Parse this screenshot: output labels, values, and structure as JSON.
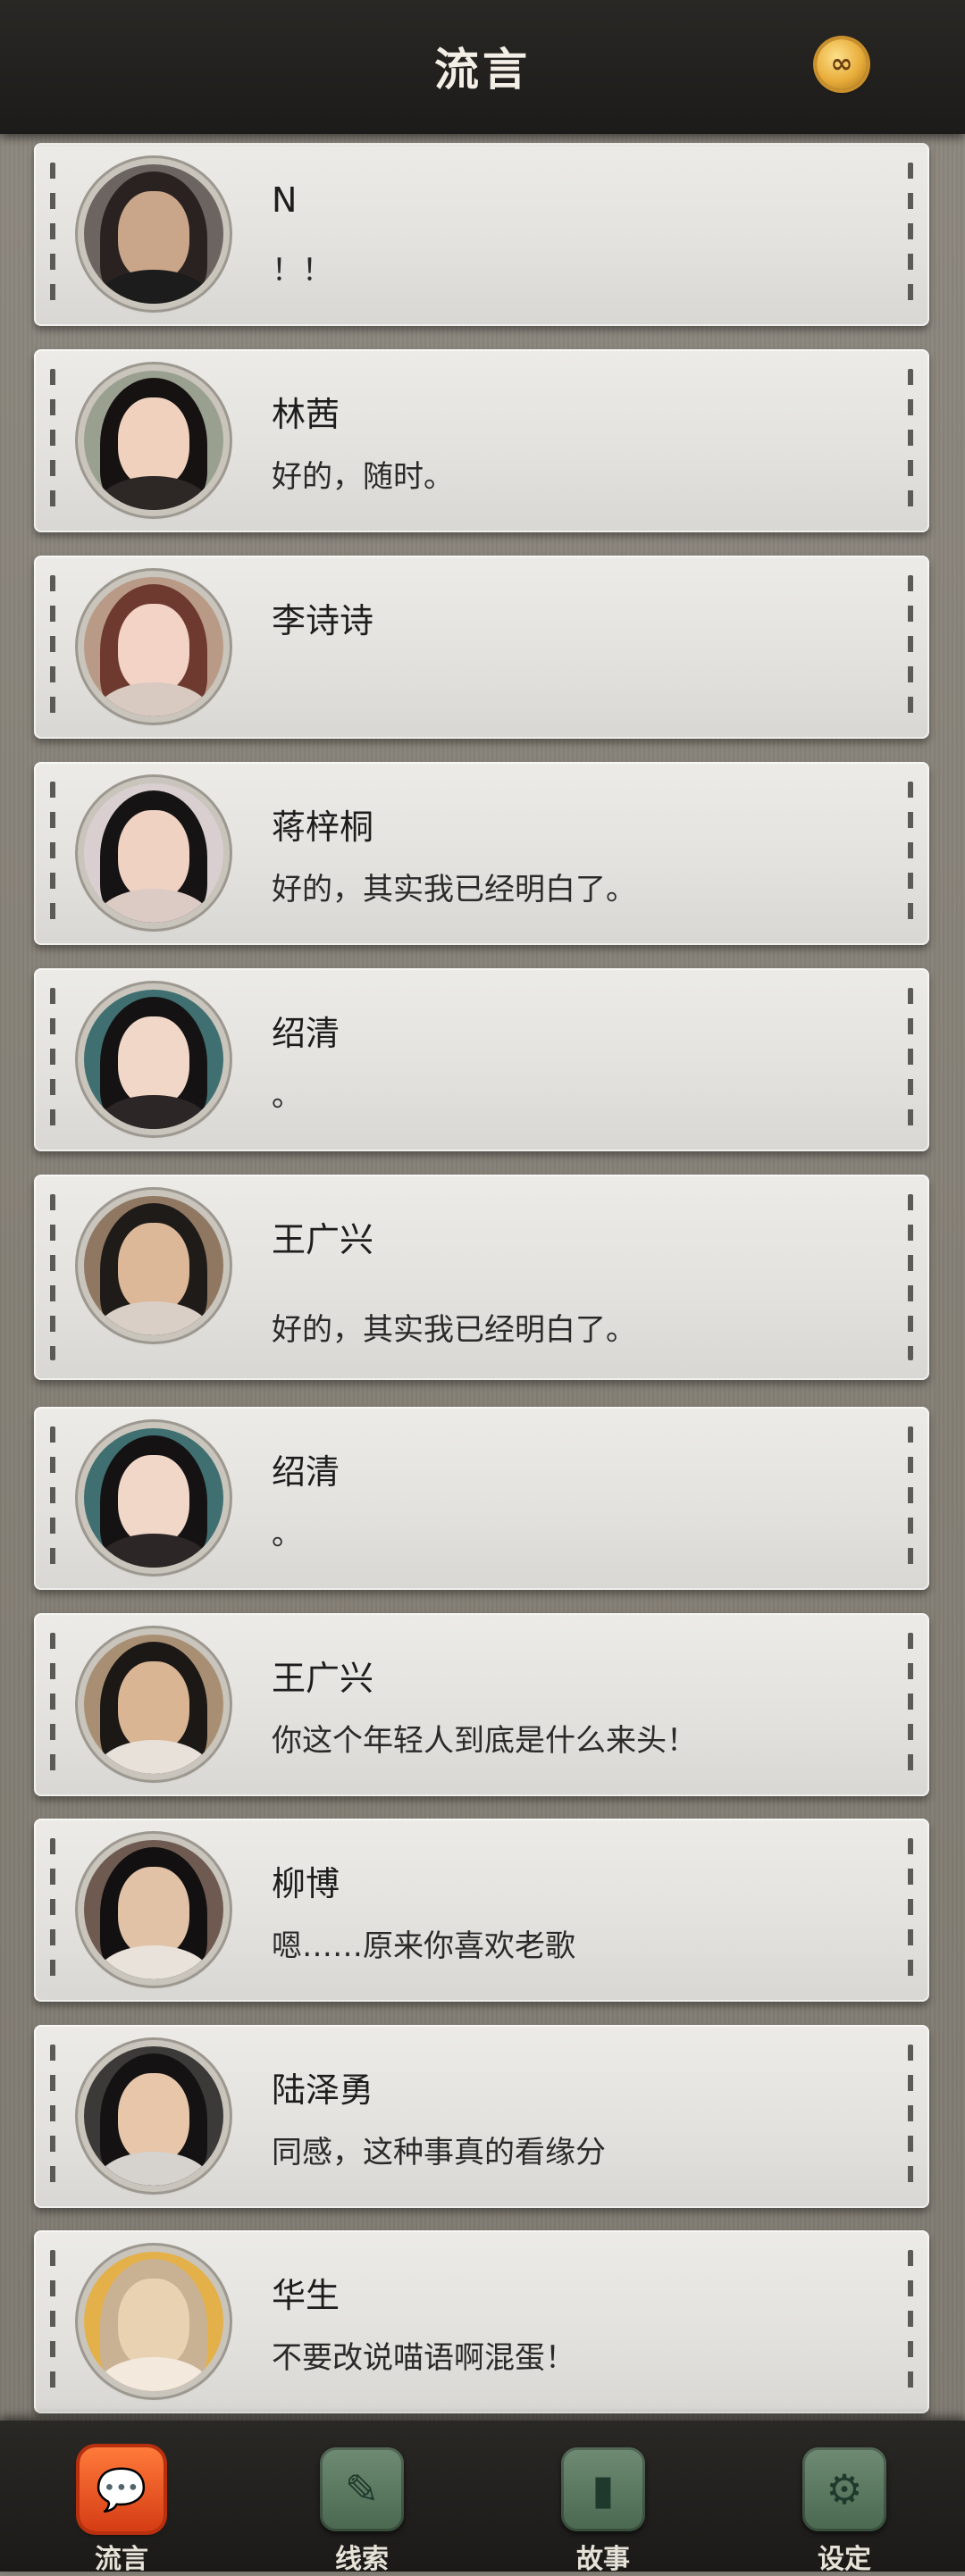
{
  "header": {
    "title": "流言",
    "coin_icon": "infinity-coin-icon",
    "coin_symbol": "∞"
  },
  "contacts": [
    {
      "name": "N",
      "message": "！！",
      "avatar": {
        "skin": "#c9a58a",
        "hair": "#2a2220",
        "cloth": "#1c1c1c",
        "bg": "#6b6460"
      }
    },
    {
      "name": "林茜",
      "message": "好的，随时。",
      "avatar": {
        "skin": "#f0d1bd",
        "hair": "#151211",
        "cloth": "#2d2725",
        "bg": "#9aa090"
      }
    },
    {
      "name": "李诗诗",
      "message": "",
      "avatar": {
        "skin": "#f3d3c5",
        "hair": "#6e3a30",
        "cloth": "#d8c9c1",
        "bg": "#b99a86"
      }
    },
    {
      "name": "蒋梓桐",
      "message": "好的，其实我已经明白了。",
      "avatar": {
        "skin": "#f0d2c3",
        "hair": "#161314",
        "cloth": "#dccbc4",
        "bg": "#d9cfd0"
      }
    },
    {
      "name": "绍清",
      "message": "。",
      "avatar": {
        "skin": "#f1d7c8",
        "hair": "#151213",
        "cloth": "#2d2626",
        "bg": "#3f6f70"
      }
    },
    {
      "name": "王广兴",
      "message": "好的，其实我已经明白了。",
      "avatar": {
        "skin": "#dcb898",
        "hair": "#1f1b18",
        "cloth": "#d9cfc6",
        "bg": "#8f7762"
      }
    },
    {
      "name": "绍清",
      "message": "。",
      "avatar": {
        "skin": "#f1d7c8",
        "hair": "#151213",
        "cloth": "#2d2626",
        "bg": "#3f6f70"
      }
    },
    {
      "name": "王广兴",
      "message": "你这个年轻人到底是什么来头！",
      "avatar": {
        "skin": "#d9b594",
        "hair": "#1c1816",
        "cloth": "#e7e1da",
        "bg": "#a88f73"
      }
    },
    {
      "name": "柳博",
      "message": "嗯……原来你喜欢老歌",
      "avatar": {
        "skin": "#e2c2a6",
        "hair": "#121010",
        "cloth": "#e8e2da",
        "bg": "#6e5a50"
      }
    },
    {
      "name": "陆泽勇",
      "message": "同感，这种事真的看缘分",
      "avatar": {
        "skin": "#e7c6aa",
        "hair": "#141212",
        "cloth": "#d6d2cd",
        "bg": "#3c3a38"
      }
    },
    {
      "name": "华生",
      "message": "不要改说喵语啊混蛋！",
      "avatar": {
        "skin": "#e9d2b2",
        "hair": "#c9b294",
        "cloth": "#f3e9dc",
        "bg": "#e3b04a"
      }
    }
  ],
  "bottom_nav": [
    {
      "label": "流言",
      "icon": "chat-bubble-icon",
      "glyph": "💬",
      "active": true
    },
    {
      "label": "线索",
      "icon": "clue-notes-icon",
      "glyph": "✎",
      "active": false
    },
    {
      "label": "故事",
      "icon": "story-book-icon",
      "glyph": "▮",
      "active": false
    },
    {
      "label": "设定",
      "icon": "settings-gear-icon",
      "glyph": "⚙",
      "active": false
    }
  ]
}
